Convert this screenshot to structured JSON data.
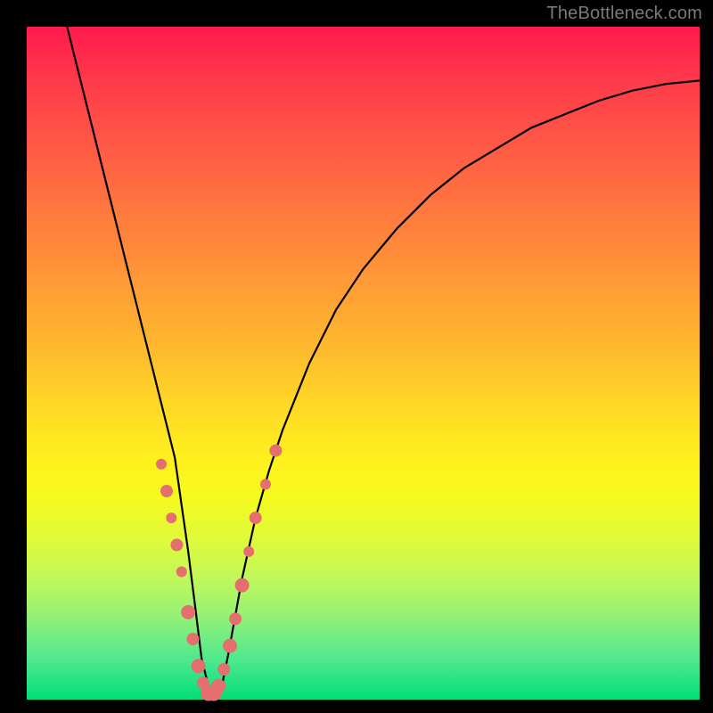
{
  "watermark": "TheBottleneck.com",
  "colors": {
    "frame": "#000000",
    "dot": "#e56e6e",
    "curve": "#000000",
    "gradient_top": "#ff1a4c",
    "gradient_bottom": "#00df78"
  },
  "chart_data": {
    "type": "line",
    "title": "",
    "xlabel": "",
    "ylabel": "",
    "xlim": [
      0,
      100
    ],
    "ylim": [
      0,
      100
    ],
    "note": "Axes are unlabeled; values are estimated from pixel positions on a 0–100 normalized grid where (0,0) is bottom-left of the gradient plot area. Background gradient runs red (y=100) → green (y=0).",
    "series": [
      {
        "name": "bottleneck-curve",
        "x": [
          6,
          8,
          10,
          12,
          14,
          16,
          18,
          20,
          22,
          24,
          25,
          26,
          27,
          28,
          29,
          30,
          32,
          34,
          36,
          38,
          42,
          46,
          50,
          55,
          60,
          65,
          70,
          75,
          80,
          85,
          90,
          95,
          100
        ],
        "y": [
          100,
          92,
          84,
          76,
          68,
          60,
          52,
          44,
          36,
          22,
          14,
          6,
          2,
          0,
          2,
          7,
          18,
          27,
          34,
          40,
          50,
          58,
          64,
          70,
          75,
          79,
          82,
          85,
          87,
          89,
          90.5,
          91.5,
          92
        ]
      }
    ],
    "scatter": {
      "name": "highlight-dots",
      "x": [
        20.0,
        20.8,
        21.5,
        22.3,
        23.0,
        24.0,
        24.7,
        25.5,
        26.2,
        27.0,
        27.8,
        28.5,
        29.3,
        30.2,
        31.0,
        32.0,
        33.0,
        34.0,
        35.5,
        37.0
      ],
      "y": [
        35.0,
        31.0,
        27.0,
        23.0,
        19.0,
        13.0,
        9.0,
        5.0,
        2.5,
        1.0,
        1.0,
        2.0,
        4.5,
        8.0,
        12.0,
        17.0,
        22.0,
        27.0,
        32.0,
        37.0
      ],
      "r": [
        6,
        7,
        6,
        7,
        6,
        8,
        7,
        8,
        7,
        9,
        9,
        8,
        7,
        8,
        7,
        8,
        6,
        7,
        6,
        7
      ]
    }
  }
}
